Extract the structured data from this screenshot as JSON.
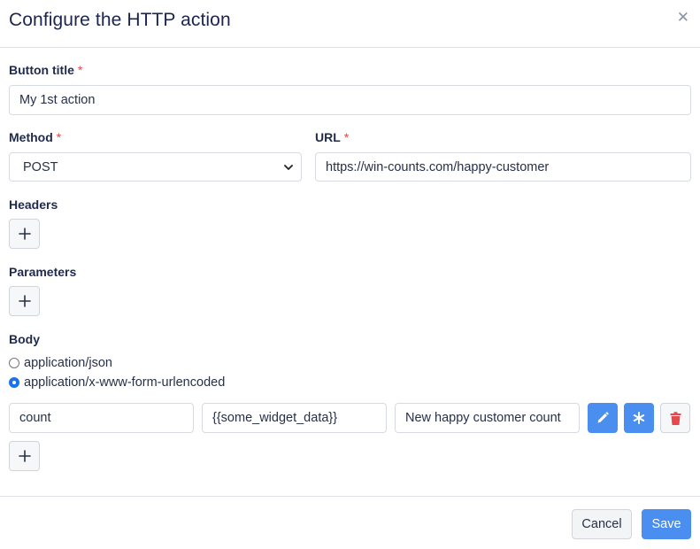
{
  "dialog": {
    "title": "Configure the HTTP action",
    "close_icon": "close-icon"
  },
  "form": {
    "button_title": {
      "label": "Button title",
      "required_mark": "*",
      "value": "My 1st action"
    },
    "method": {
      "label": "Method",
      "required_mark": "*",
      "selected": "POST"
    },
    "url": {
      "label": "URL",
      "required_mark": "*",
      "value": "https://win-counts.com/happy-customer"
    },
    "headers": {
      "label": "Headers",
      "add_icon": "plus-icon"
    },
    "parameters": {
      "label": "Parameters",
      "add_icon": "plus-icon"
    },
    "body": {
      "label": "Body",
      "options": [
        {
          "label": "application/json",
          "checked": false
        },
        {
          "label": "application/x-www-form-urlencoded",
          "checked": true
        }
      ],
      "row": {
        "key": "count",
        "value": "{{some_widget_data}}",
        "description": "New happy customer count",
        "actions": [
          "pencil-icon",
          "star-icon",
          "trash-icon"
        ]
      },
      "add_icon": "plus-icon"
    }
  },
  "footer": {
    "cancel_label": "Cancel",
    "save_label": "Save"
  },
  "colors": {
    "primary": "#4a8ef0",
    "danger": "#e5484d",
    "text": "#1f2a4d"
  }
}
